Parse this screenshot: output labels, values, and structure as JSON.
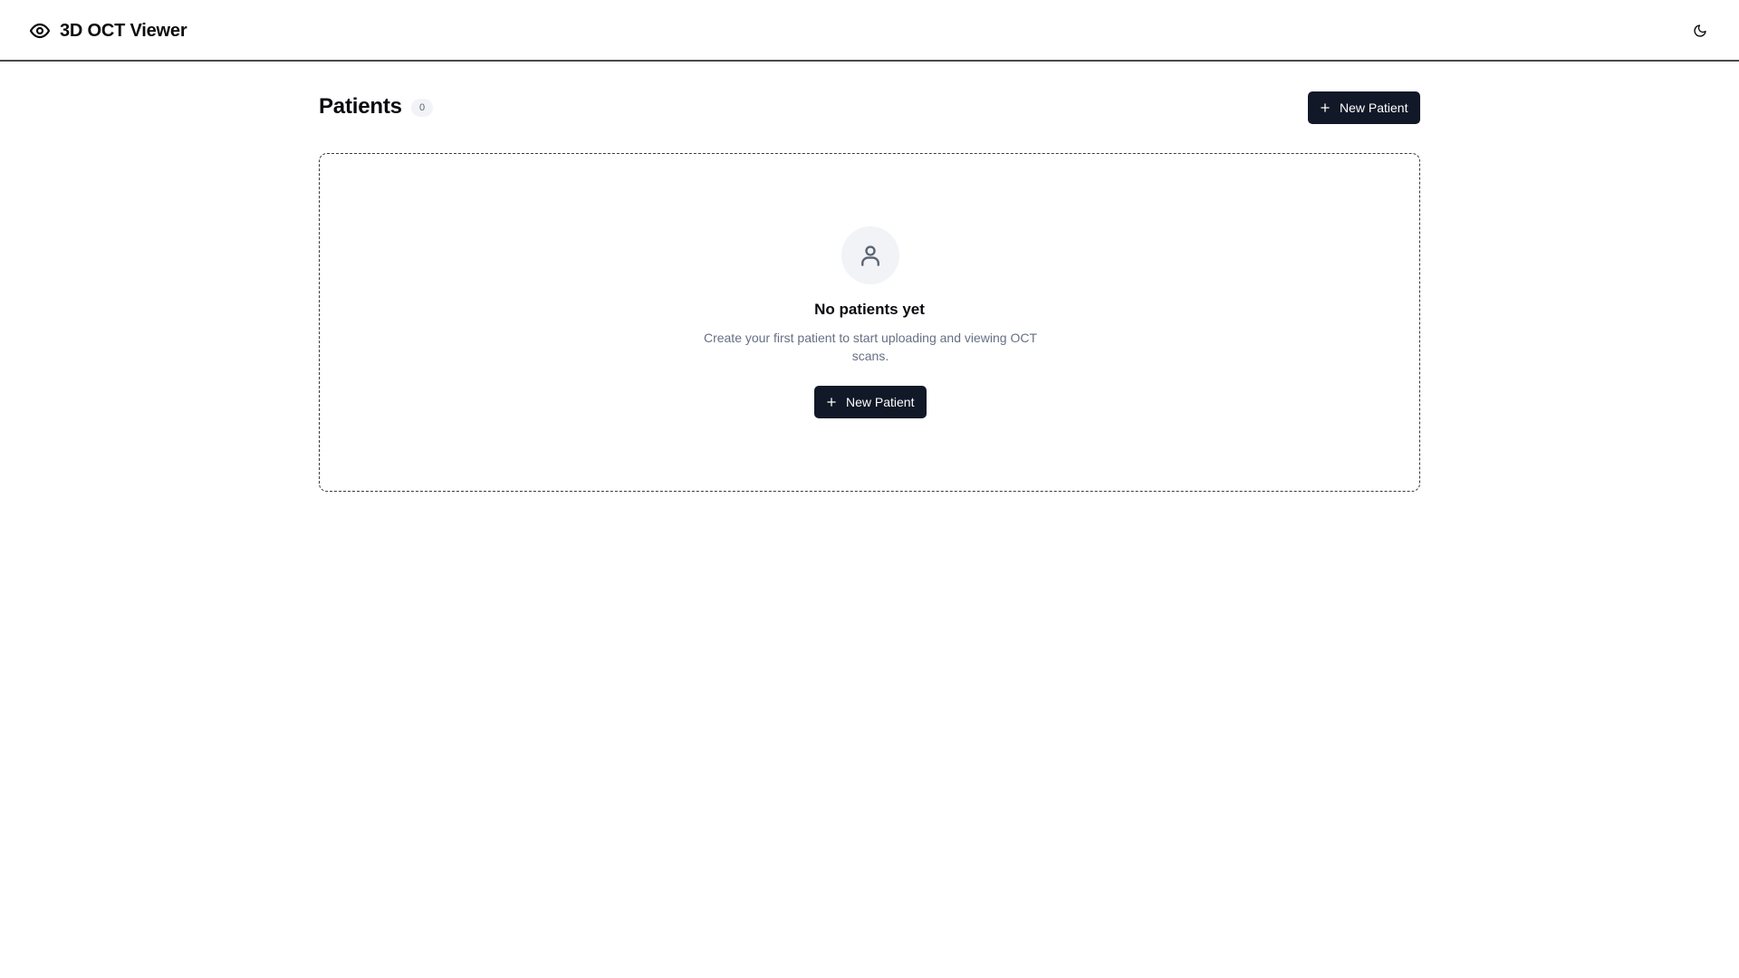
{
  "app": {
    "title": "3D OCT Viewer",
    "brand_icon": "eye-icon",
    "theme_toggle_icon": "moon-icon"
  },
  "page": {
    "title": "Patients",
    "count": "0",
    "new_button_label": "New Patient",
    "new_button_icon": "plus-icon"
  },
  "empty_state": {
    "icon": "user-icon",
    "title": "No patients yet",
    "description": "Create your first patient to start uploading and viewing OCT scans.",
    "button_label": "New Patient",
    "button_icon": "plus-icon"
  },
  "colors": {
    "primary_button": "#111827",
    "muted_text": "#667085",
    "badge_background": "#f1f3f7"
  }
}
